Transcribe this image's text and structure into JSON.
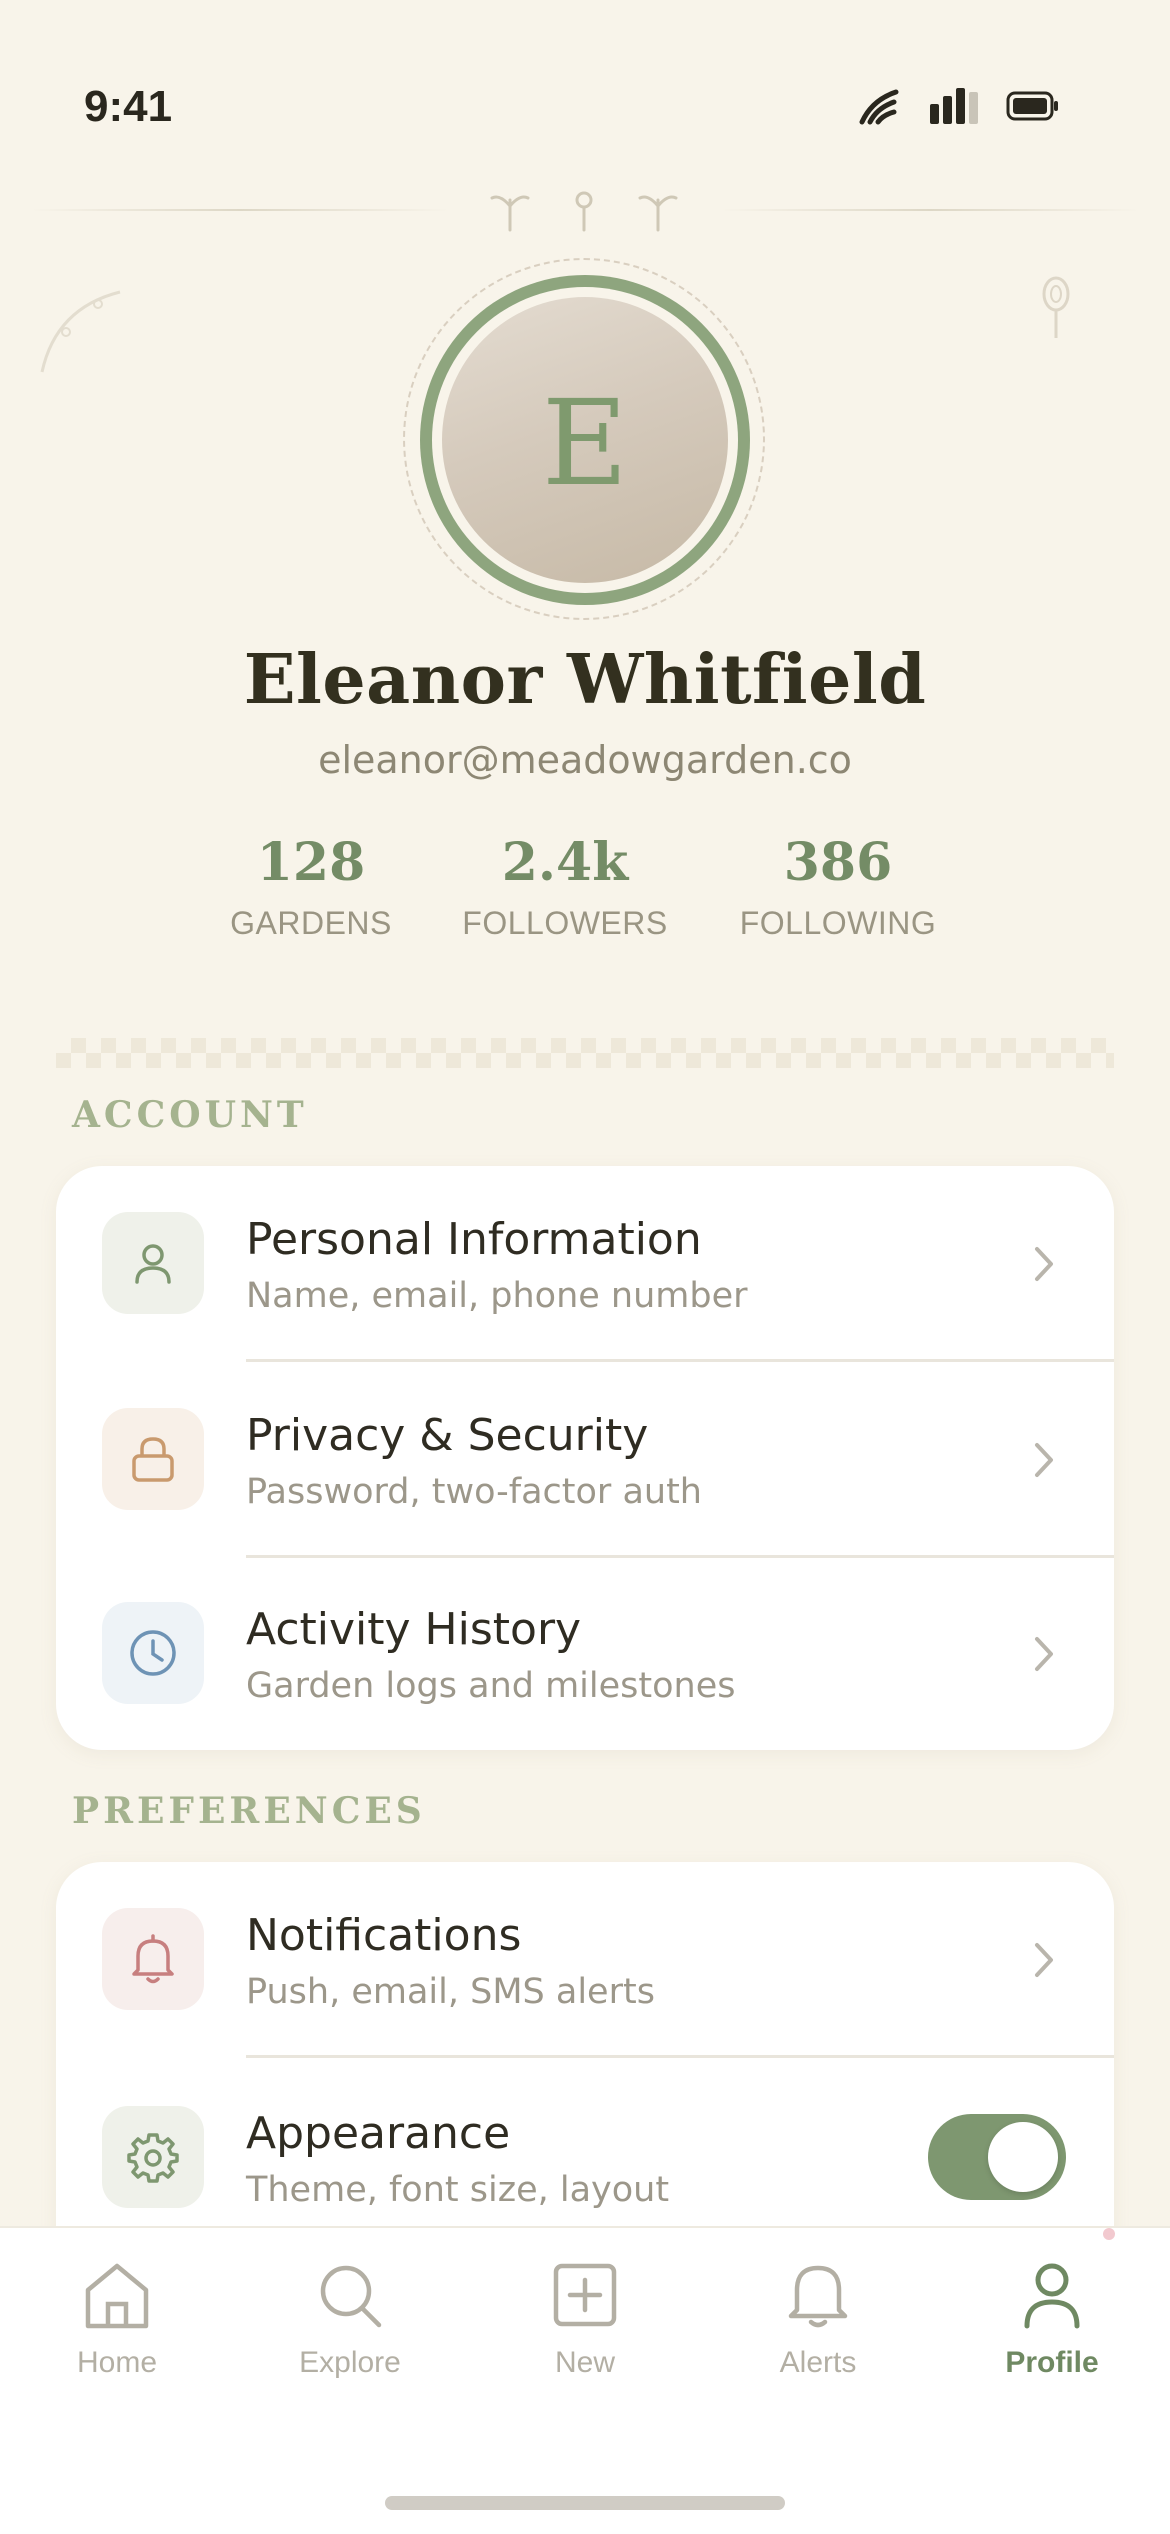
{
  "status_bar": {
    "time": "9:41",
    "icons": [
      "wifi-icon",
      "signal-icon",
      "battery-icon"
    ]
  },
  "profile": {
    "avatar_initial": "E",
    "name": "Eleanor Whitfield",
    "email": "eleanor@meadowgarden.co",
    "stats": [
      {
        "value": "128",
        "label": "GARDENS"
      },
      {
        "value": "2.4k",
        "label": "FOLLOWERS"
      },
      {
        "value": "386",
        "label": "FOLLOWING"
      }
    ]
  },
  "sections": {
    "account": {
      "label": "ACCOUNT",
      "items": [
        {
          "title": "Personal Information",
          "subtitle": "Name, email, phone number",
          "icon": "user-icon",
          "accent": "#7E9770"
        },
        {
          "title": "Privacy & Security",
          "subtitle": "Password, two-factor auth",
          "icon": "lock-icon",
          "accent": "#C99A6E"
        },
        {
          "title": "Activity History",
          "subtitle": "Garden logs and milestones",
          "icon": "clock-icon",
          "accent": "#6E93B5"
        }
      ]
    },
    "preferences": {
      "label": "PREFERENCES",
      "items": [
        {
          "title": "Notifications",
          "subtitle": "Push, email, SMS alerts",
          "icon": "bell-icon",
          "accent": "#C77F7F"
        },
        {
          "title": "Appearance",
          "subtitle": "Theme, font size, layout",
          "icon": "gear-icon",
          "accent": "#7E9770",
          "toggle_on": true
        }
      ]
    }
  },
  "tab_bar": {
    "tabs": [
      {
        "label": "Home",
        "icon": "home-icon"
      },
      {
        "label": "Explore",
        "icon": "search-icon"
      },
      {
        "label": "New",
        "icon": "plus-square-icon"
      },
      {
        "label": "Alerts",
        "icon": "bell-icon"
      },
      {
        "label": "Profile",
        "icon": "user-icon",
        "active": true
      }
    ]
  },
  "colors": {
    "background": "#F8F4EA",
    "accent_green": "#7E9770",
    "section_label": "#A5B38F"
  }
}
